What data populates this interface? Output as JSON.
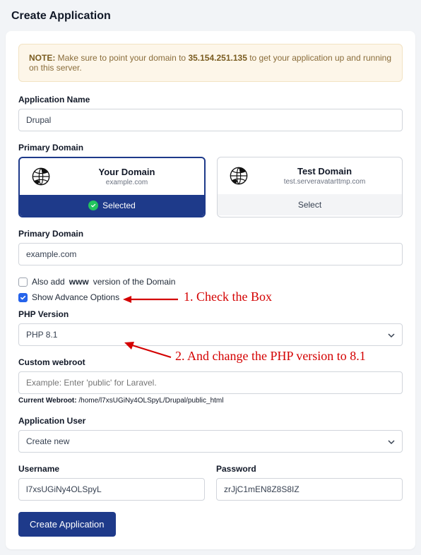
{
  "page_title": "Create Application",
  "note": {
    "prefix": "NOTE:",
    "before": " Make sure to point your domain to ",
    "ip": "35.154.251.135",
    "after": " to get your application up and running on this server."
  },
  "app_name": {
    "label": "Application Name",
    "value": "Drupal"
  },
  "primary_domain_cards": {
    "label": "Primary Domain",
    "your": {
      "title": "Your Domain",
      "sub": "example.com",
      "footer": "Selected"
    },
    "test": {
      "title": "Test Domain",
      "sub": "test.serveravatarttmp.com",
      "footer": "Select"
    }
  },
  "primary_domain_input": {
    "label": "Primary Domain",
    "value": "example.com"
  },
  "www_row": {
    "prefix": "Also add ",
    "bold": "www",
    "suffix": " version of the Domain"
  },
  "advance_row": {
    "label": "Show Advance Options"
  },
  "php_version": {
    "label": "PHP Version",
    "value": "PHP 8.1"
  },
  "custom_webroot": {
    "label": "Custom webroot",
    "placeholder": "Example: Enter 'public' for Laravel.",
    "current_label": "Current Webroot:",
    "current_value": " /home/l7xsUGiNy4OLSpyL/Drupal/public_html"
  },
  "app_user": {
    "label": "Application User",
    "value": "Create new"
  },
  "username": {
    "label": "Username",
    "value": "l7xsUGiNy4OLSpyL"
  },
  "password": {
    "label": "Password",
    "value": "zrJjC1mEN8Z8S8IZ"
  },
  "submit": "Create Application",
  "anno1": "1. Check the Box",
  "anno2": "2. And change the PHP version to 8.1"
}
